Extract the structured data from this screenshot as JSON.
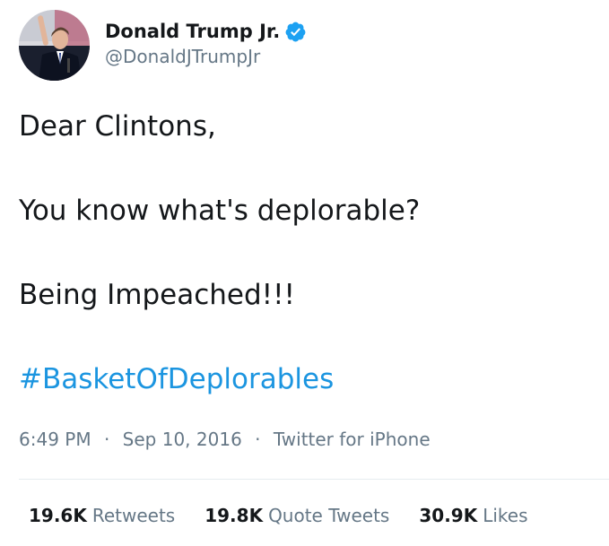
{
  "author": {
    "display_name": "Donald Trump Jr.",
    "handle": "@DonaldJTrumpJr",
    "verified": true,
    "avatar_icon": "profile-photo"
  },
  "tweet": {
    "lines": [
      "Dear Clintons,",
      "You know what's deplorable?",
      "Being Impeached!!!"
    ],
    "hashtag": "#BasketOfDeplorables"
  },
  "meta": {
    "time": "6:49 PM",
    "date": "Sep 10, 2016",
    "separator": "·",
    "source": "Twitter for iPhone"
  },
  "stats": {
    "retweets": {
      "count": "19.6K",
      "label": "Retweets"
    },
    "quote_tweets": {
      "count": "19.8K",
      "label": "Quote Tweets"
    },
    "likes": {
      "count": "30.9K",
      "label": "Likes"
    }
  },
  "colors": {
    "text": "#14171a",
    "secondary": "#657786",
    "link": "#1b95e0",
    "verified": "#1da1f2",
    "divider": "#e6ecf0"
  }
}
